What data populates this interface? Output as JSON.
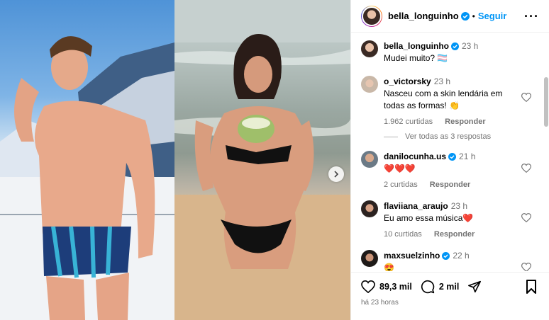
{
  "header": {
    "username": "bella_longuinho",
    "separator": "•",
    "follow_label": "Seguir",
    "more_icon": "more-horizontal-icon"
  },
  "caption": {
    "username": "bella_longuinho",
    "time": "23 h",
    "text": "Mudei muito? 🏳️‍⚧️"
  },
  "comments": [
    {
      "username": "o_victorsky",
      "time": "23 h",
      "text": "Nasceu com a skin lendária em todas as formas! 👏",
      "likes": "1.962 curtidas",
      "reply_label": "Responder",
      "view_replies": "Ver todas as 3 respostas"
    },
    {
      "username": "danilocunha.us",
      "time": "21 h",
      "text": "❤️❤️❤️",
      "likes": "2 curtidas",
      "reply_label": "Responder"
    },
    {
      "username": "flaviiana_araujo",
      "time": "23 h",
      "text": "Eu amo essa música❤️",
      "likes": "10 curtidas",
      "reply_label": "Responder"
    },
    {
      "username": "maxsuelzinho",
      "time": "22 h",
      "text": "😍"
    }
  ],
  "actions": {
    "likes_count": "89,3 mil",
    "comments_count": "2 mil",
    "post_age": "há 23 horas"
  },
  "colors": {
    "accent": "#0095f6",
    "secondary_text": "#737373",
    "verified": "#0095f6"
  }
}
